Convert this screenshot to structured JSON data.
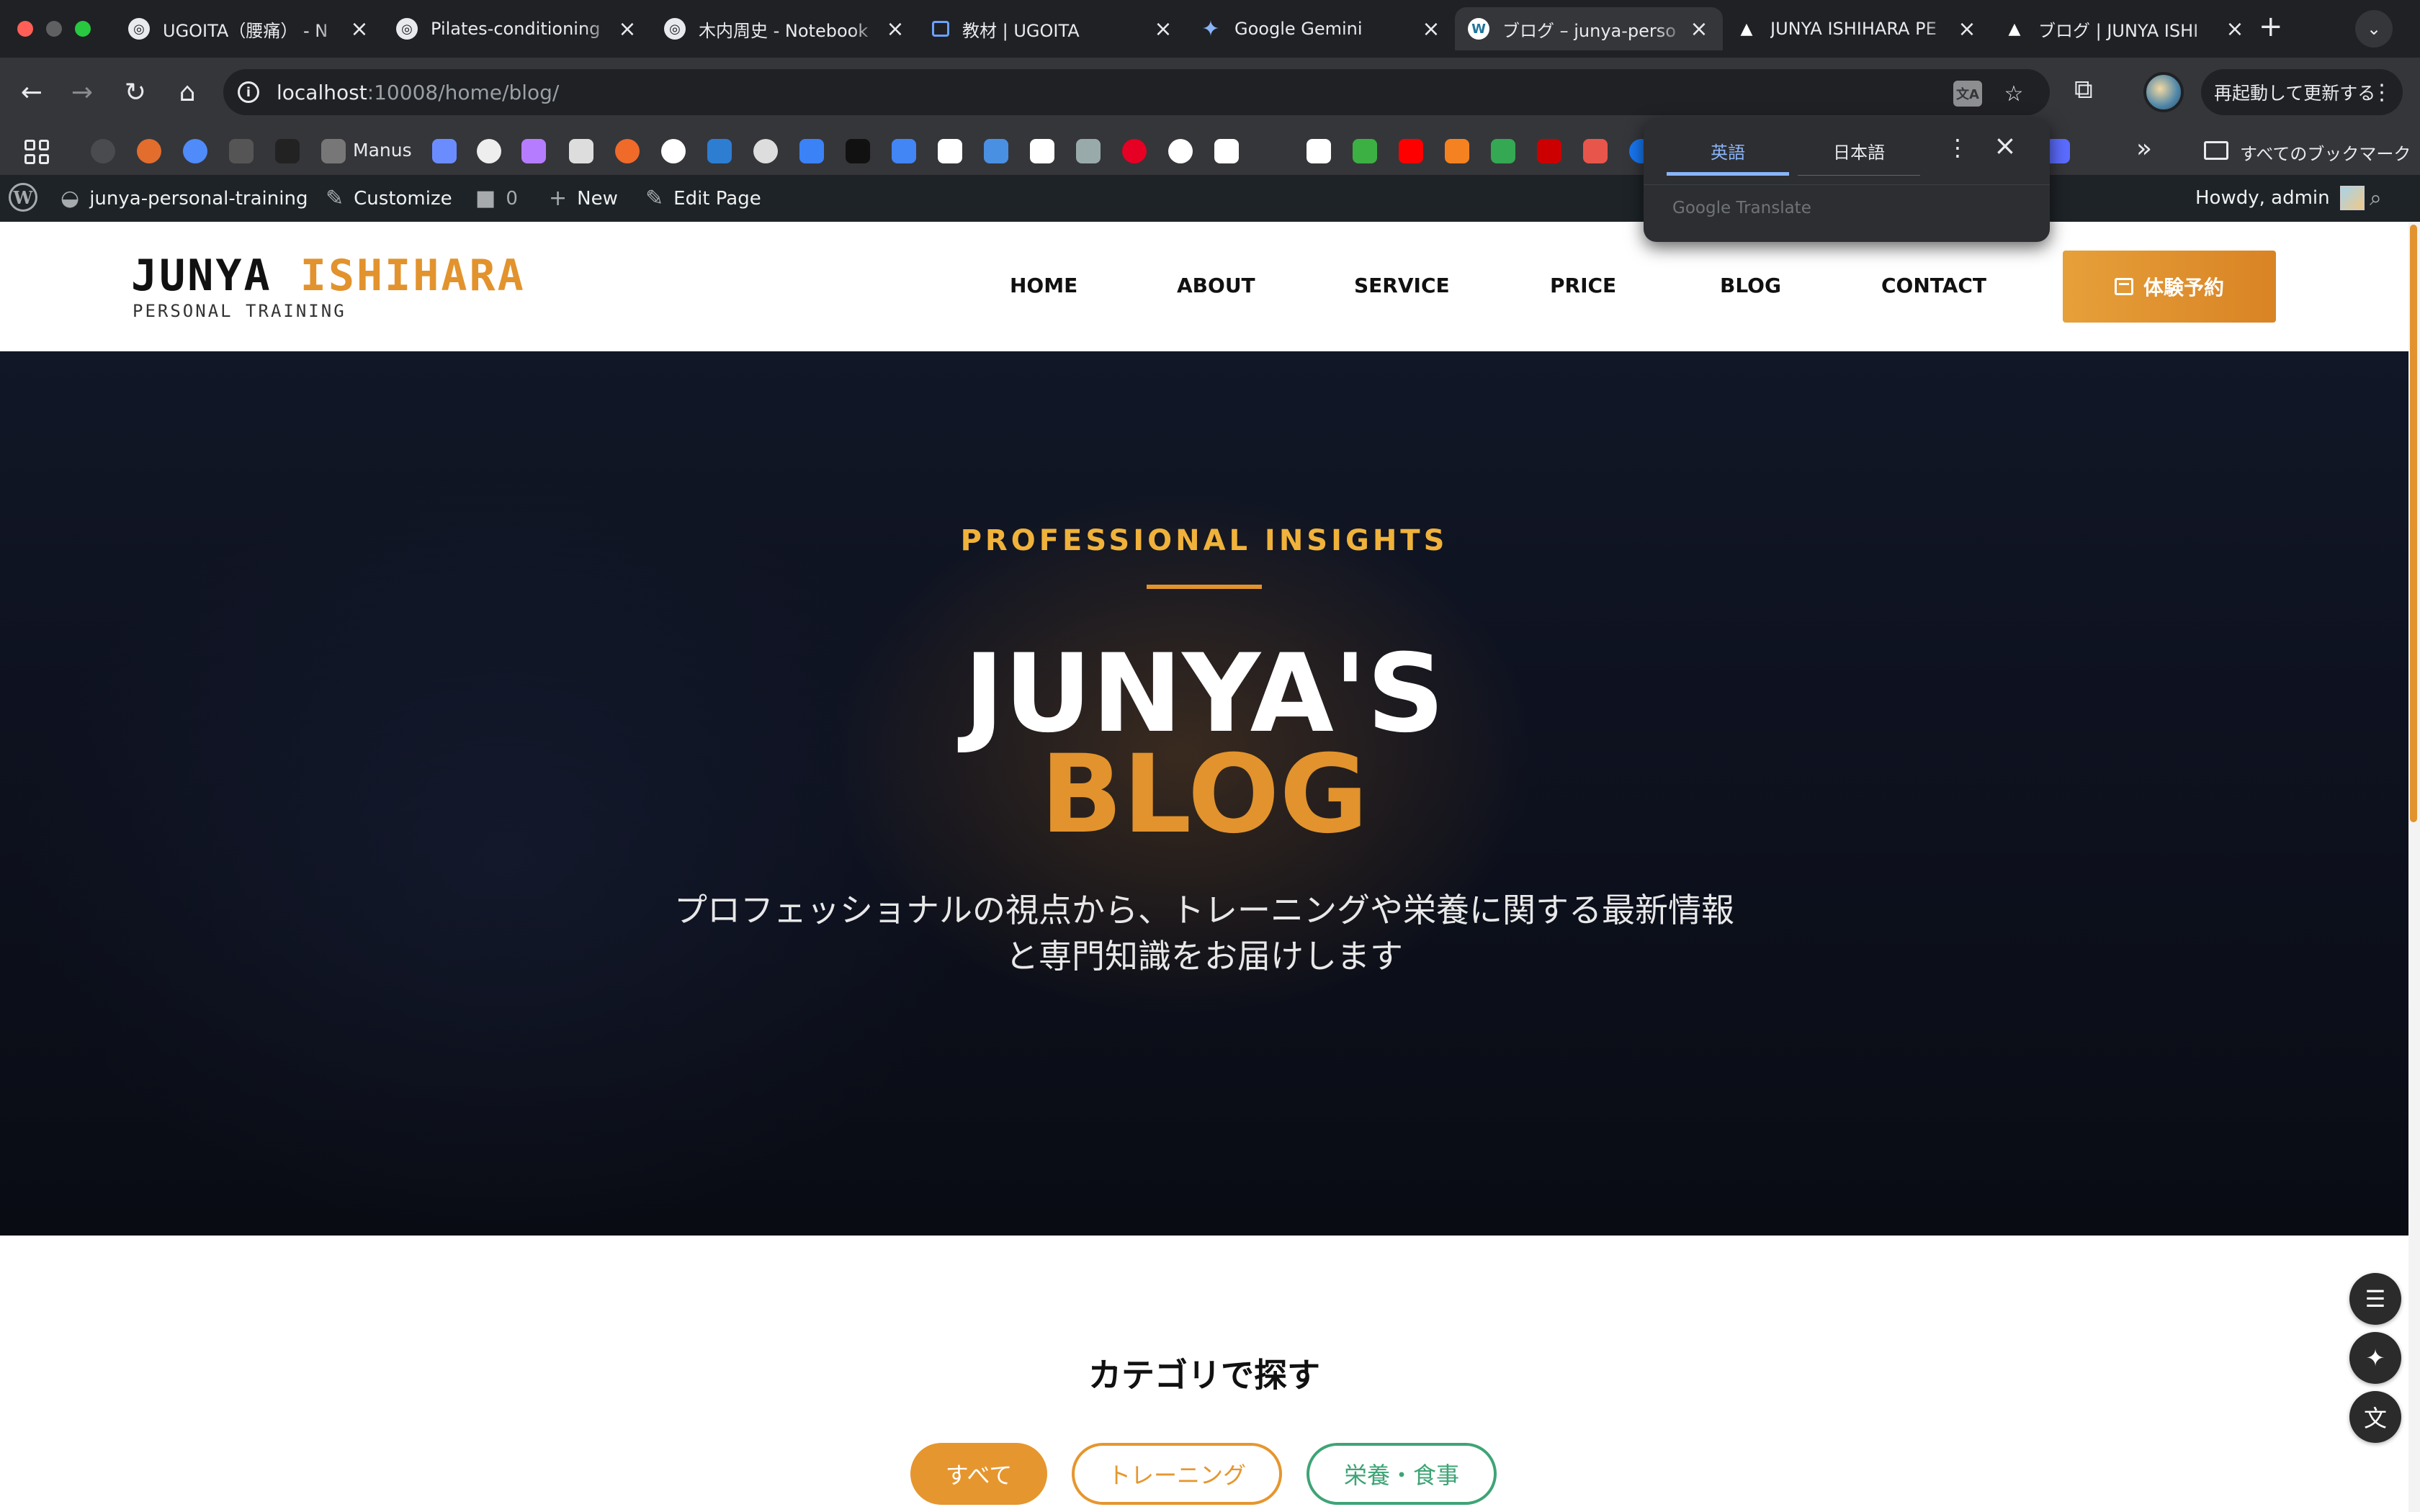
{
  "browser": {
    "tabs": [
      {
        "title": "UGOITA（腰痛） - N",
        "icon": "notebook-icon"
      },
      {
        "title": "Pilates-conditioning",
        "icon": "notebook-icon"
      },
      {
        "title": "木内周史 - Notebook",
        "icon": "notebook-icon"
      },
      {
        "title": "教材 | UGOITA",
        "icon": "docs-icon"
      },
      {
        "title": "Google Gemini",
        "icon": "gemini-icon"
      },
      {
        "title": "ブログ – junya-perso",
        "icon": "wordpress-icon",
        "active": true
      },
      {
        "title": "JUNYA ISHIHARA PE",
        "icon": "triangle-icon"
      },
      {
        "title": "ブログ | JUNYA ISHI",
        "icon": "triangle-icon"
      }
    ],
    "url_host": "localhost",
    "url_path": ":10008/home/blog/",
    "update_label": "再起動して更新する",
    "bookmarks": {
      "manus_label": "Manus",
      "all_bookmarks_label": "すべてのブックマーク"
    }
  },
  "translate_popup": {
    "source_lang": "英語",
    "target_lang": "日本語",
    "brand": "Google Translate"
  },
  "admin_bar": {
    "site_name": "junya-personal-training",
    "customize": "Customize",
    "comments": "0",
    "new": "New",
    "edit_page": "Edit Page",
    "howdy": "Howdy, admin"
  },
  "site": {
    "logo_first": "JUNYA",
    "logo_second": "ISHIHARA",
    "logo_sub": "PERSONAL TRAINING",
    "nav": [
      "HOME",
      "ABOUT",
      "SERVICE",
      "PRICE",
      "BLOG",
      "CONTACT"
    ],
    "cta": "体験予約"
  },
  "hero": {
    "eyebrow": "PROFESSIONAL INSIGHTS",
    "title_line1": "JUNYA'S",
    "title_line2": "BLOG",
    "desc_line1": "プロフェッショナルの視点から、トレーニングや栄養に関する最新情報",
    "desc_line2": "と専門知識をお届けします"
  },
  "categories": {
    "title": "カテゴリで探す",
    "chips": [
      "すべて",
      "トレーニング",
      "栄養・食事"
    ]
  },
  "colors": {
    "accent": "#e2932d",
    "hero_bg": "#0e1220",
    "food_green": "#3ea476"
  }
}
